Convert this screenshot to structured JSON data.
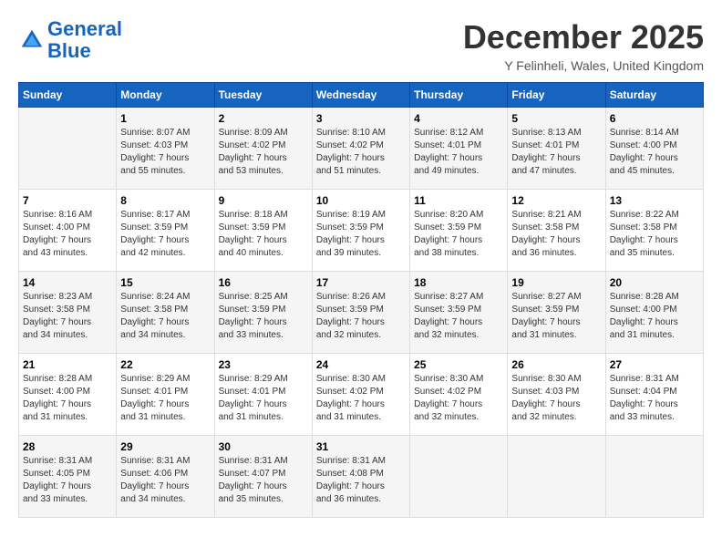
{
  "logo": {
    "line1": "General",
    "line2": "Blue"
  },
  "title": "December 2025",
  "subtitle": "Y Felinheli, Wales, United Kingdom",
  "days_of_week": [
    "Sunday",
    "Monday",
    "Tuesday",
    "Wednesday",
    "Thursday",
    "Friday",
    "Saturday"
  ],
  "weeks": [
    [
      {
        "day": "",
        "info": ""
      },
      {
        "day": "1",
        "info": "Sunrise: 8:07 AM\nSunset: 4:03 PM\nDaylight: 7 hours\nand 55 minutes."
      },
      {
        "day": "2",
        "info": "Sunrise: 8:09 AM\nSunset: 4:02 PM\nDaylight: 7 hours\nand 53 minutes."
      },
      {
        "day": "3",
        "info": "Sunrise: 8:10 AM\nSunset: 4:02 PM\nDaylight: 7 hours\nand 51 minutes."
      },
      {
        "day": "4",
        "info": "Sunrise: 8:12 AM\nSunset: 4:01 PM\nDaylight: 7 hours\nand 49 minutes."
      },
      {
        "day": "5",
        "info": "Sunrise: 8:13 AM\nSunset: 4:01 PM\nDaylight: 7 hours\nand 47 minutes."
      },
      {
        "day": "6",
        "info": "Sunrise: 8:14 AM\nSunset: 4:00 PM\nDaylight: 7 hours\nand 45 minutes."
      }
    ],
    [
      {
        "day": "7",
        "info": "Sunrise: 8:16 AM\nSunset: 4:00 PM\nDaylight: 7 hours\nand 43 minutes."
      },
      {
        "day": "8",
        "info": "Sunrise: 8:17 AM\nSunset: 3:59 PM\nDaylight: 7 hours\nand 42 minutes."
      },
      {
        "day": "9",
        "info": "Sunrise: 8:18 AM\nSunset: 3:59 PM\nDaylight: 7 hours\nand 40 minutes."
      },
      {
        "day": "10",
        "info": "Sunrise: 8:19 AM\nSunset: 3:59 PM\nDaylight: 7 hours\nand 39 minutes."
      },
      {
        "day": "11",
        "info": "Sunrise: 8:20 AM\nSunset: 3:59 PM\nDaylight: 7 hours\nand 38 minutes."
      },
      {
        "day": "12",
        "info": "Sunrise: 8:21 AM\nSunset: 3:58 PM\nDaylight: 7 hours\nand 36 minutes."
      },
      {
        "day": "13",
        "info": "Sunrise: 8:22 AM\nSunset: 3:58 PM\nDaylight: 7 hours\nand 35 minutes."
      }
    ],
    [
      {
        "day": "14",
        "info": "Sunrise: 8:23 AM\nSunset: 3:58 PM\nDaylight: 7 hours\nand 34 minutes."
      },
      {
        "day": "15",
        "info": "Sunrise: 8:24 AM\nSunset: 3:58 PM\nDaylight: 7 hours\nand 34 minutes."
      },
      {
        "day": "16",
        "info": "Sunrise: 8:25 AM\nSunset: 3:59 PM\nDaylight: 7 hours\nand 33 minutes."
      },
      {
        "day": "17",
        "info": "Sunrise: 8:26 AM\nSunset: 3:59 PM\nDaylight: 7 hours\nand 32 minutes."
      },
      {
        "day": "18",
        "info": "Sunrise: 8:27 AM\nSunset: 3:59 PM\nDaylight: 7 hours\nand 32 minutes."
      },
      {
        "day": "19",
        "info": "Sunrise: 8:27 AM\nSunset: 3:59 PM\nDaylight: 7 hours\nand 31 minutes."
      },
      {
        "day": "20",
        "info": "Sunrise: 8:28 AM\nSunset: 4:00 PM\nDaylight: 7 hours\nand 31 minutes."
      }
    ],
    [
      {
        "day": "21",
        "info": "Sunrise: 8:28 AM\nSunset: 4:00 PM\nDaylight: 7 hours\nand 31 minutes."
      },
      {
        "day": "22",
        "info": "Sunrise: 8:29 AM\nSunset: 4:01 PM\nDaylight: 7 hours\nand 31 minutes."
      },
      {
        "day": "23",
        "info": "Sunrise: 8:29 AM\nSunset: 4:01 PM\nDaylight: 7 hours\nand 31 minutes."
      },
      {
        "day": "24",
        "info": "Sunrise: 8:30 AM\nSunset: 4:02 PM\nDaylight: 7 hours\nand 31 minutes."
      },
      {
        "day": "25",
        "info": "Sunrise: 8:30 AM\nSunset: 4:02 PM\nDaylight: 7 hours\nand 32 minutes."
      },
      {
        "day": "26",
        "info": "Sunrise: 8:30 AM\nSunset: 4:03 PM\nDaylight: 7 hours\nand 32 minutes."
      },
      {
        "day": "27",
        "info": "Sunrise: 8:31 AM\nSunset: 4:04 PM\nDaylight: 7 hours\nand 33 minutes."
      }
    ],
    [
      {
        "day": "28",
        "info": "Sunrise: 8:31 AM\nSunset: 4:05 PM\nDaylight: 7 hours\nand 33 minutes."
      },
      {
        "day": "29",
        "info": "Sunrise: 8:31 AM\nSunset: 4:06 PM\nDaylight: 7 hours\nand 34 minutes."
      },
      {
        "day": "30",
        "info": "Sunrise: 8:31 AM\nSunset: 4:07 PM\nDaylight: 7 hours\nand 35 minutes."
      },
      {
        "day": "31",
        "info": "Sunrise: 8:31 AM\nSunset: 4:08 PM\nDaylight: 7 hours\nand 36 minutes."
      },
      {
        "day": "",
        "info": ""
      },
      {
        "day": "",
        "info": ""
      },
      {
        "day": "",
        "info": ""
      }
    ]
  ]
}
